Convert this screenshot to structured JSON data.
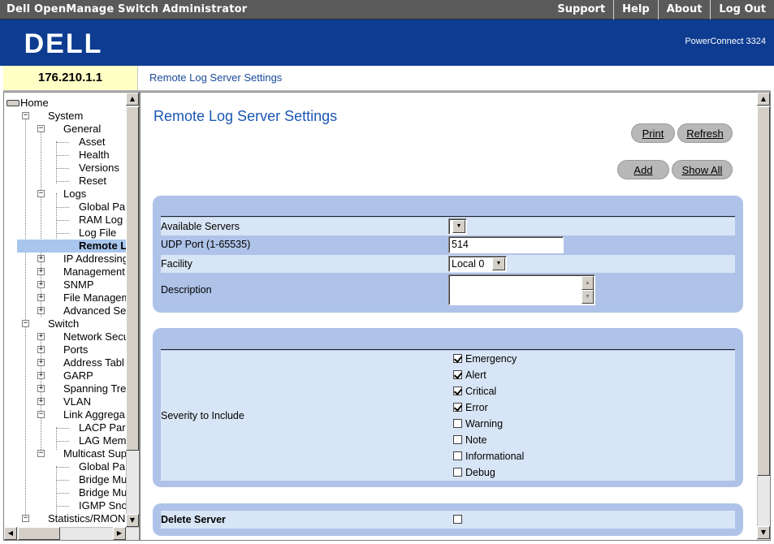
{
  "topbar": {
    "title": "Dell OpenManage Switch Administrator",
    "menu": [
      "Support",
      "Help",
      "About",
      "Log Out"
    ]
  },
  "brand": {
    "logo": "DELL",
    "model": "PowerConnect 3324",
    "color": "#0d3c91"
  },
  "device_ip": "176.210.1.1",
  "breadcrumb": "Remote Log Server Settings",
  "tree": [
    {
      "label": "Home",
      "expander": "",
      "icon": "monitor-icon"
    },
    {
      "label": "System",
      "expander": "minus"
    },
    {
      "label": "General",
      "expander": "minus"
    },
    {
      "label": "Asset"
    },
    {
      "label": "Health"
    },
    {
      "label": "Versions"
    },
    {
      "label": "Reset"
    },
    {
      "label": "Logs",
      "expander": "minus"
    },
    {
      "label": "Global Pa"
    },
    {
      "label": "RAM Log"
    },
    {
      "label": "Log File"
    },
    {
      "label": "Remote L",
      "selected": true
    },
    {
      "label": "IP Addressing",
      "expander": "plus"
    },
    {
      "label": "Management",
      "expander": "plus"
    },
    {
      "label": "SNMP",
      "expander": "plus"
    },
    {
      "label": "File Managem",
      "expander": "plus"
    },
    {
      "label": "Advanced Se",
      "expander": "plus"
    },
    {
      "label": "Switch",
      "expander": "minus"
    },
    {
      "label": "Network Secu",
      "expander": "plus"
    },
    {
      "label": "Ports",
      "expander": "plus"
    },
    {
      "label": "Address Tabl",
      "expander": "plus"
    },
    {
      "label": "GARP",
      "expander": "plus"
    },
    {
      "label": "Spanning Tre",
      "expander": "plus"
    },
    {
      "label": "VLAN",
      "expander": "plus"
    },
    {
      "label": "Link Aggrega",
      "expander": "minus"
    },
    {
      "label": "LACP Par"
    },
    {
      "label": "LAG Mem"
    },
    {
      "label": "Multicast Sup",
      "expander": "minus"
    },
    {
      "label": "Global Pa"
    },
    {
      "label": "Bridge Mu"
    },
    {
      "label": "Bridge Mu"
    },
    {
      "label": "IGMP Sno"
    },
    {
      "label": "Statistics/RMON",
      "expander": "minus"
    }
  ],
  "main": {
    "title": "Remote Log Server Settings",
    "buttons": {
      "print": "Print",
      "refresh": "Refresh",
      "add": "Add",
      "show_all": "Show All"
    },
    "form": {
      "available_servers_label": "Available Servers",
      "available_servers_value": "",
      "udp_port_label": "UDP Port (1-65535)",
      "udp_port_value": "514",
      "facility_label": "Facility",
      "facility_value": "Local 0",
      "description_label": "Description",
      "description_value": ""
    },
    "severity": {
      "label": "Severity to Include",
      "options": [
        {
          "label": "Emergency",
          "checked": true
        },
        {
          "label": "Alert",
          "checked": true
        },
        {
          "label": "Critical",
          "checked": true
        },
        {
          "label": "Error",
          "checked": true
        },
        {
          "label": "Warning",
          "checked": false
        },
        {
          "label": "Note",
          "checked": false
        },
        {
          "label": "Informational",
          "checked": false
        },
        {
          "label": "Debug",
          "checked": false
        }
      ]
    },
    "delete_server": {
      "label": "Delete Server",
      "checked": false
    }
  }
}
